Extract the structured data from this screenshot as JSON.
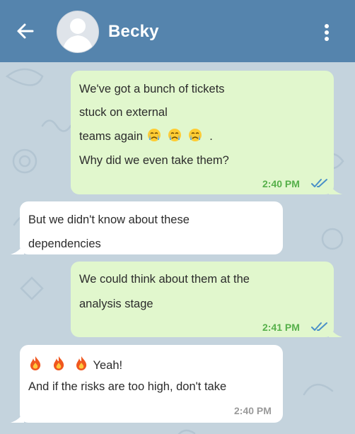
{
  "header": {
    "contact_name": "Becky",
    "back_icon": "arrow-left-icon",
    "menu_icon": "more-vertical-icon",
    "bg_color": "#5584ad"
  },
  "colors": {
    "outgoing_bubble": "#e1f7cd",
    "incoming_bubble": "#ffffff",
    "outgoing_time": "#56b04a",
    "incoming_time": "#9a9a9a",
    "read_checks": "#4a90c8"
  },
  "messages": [
    {
      "direction": "outgoing",
      "lines": [
        "We've got a bunch of tickets",
        "stuck on external",
        "teams again",
        "Why did we even take them?"
      ],
      "line3_suffix": ".",
      "emojis": [
        "crying-face-emoji",
        "crying-face-emoji",
        "crying-face-emoji"
      ],
      "time": "2:40 PM",
      "status": "read-double-check"
    },
    {
      "direction": "incoming",
      "lines": [
        "But we didn't know about these",
        "dependencies"
      ]
    },
    {
      "direction": "outgoing",
      "lines": [
        "We could think about them at the",
        "analysis stage"
      ],
      "time": "2:41 PM",
      "status": "read-double-check"
    },
    {
      "direction": "incoming",
      "emojis": [
        "fire-emoji",
        "fire-emoji",
        "fire-emoji"
      ],
      "lines": [
        "Yeah!",
        "And if the risks are too high, don't take"
      ],
      "time": "2:40 PM"
    }
  ]
}
